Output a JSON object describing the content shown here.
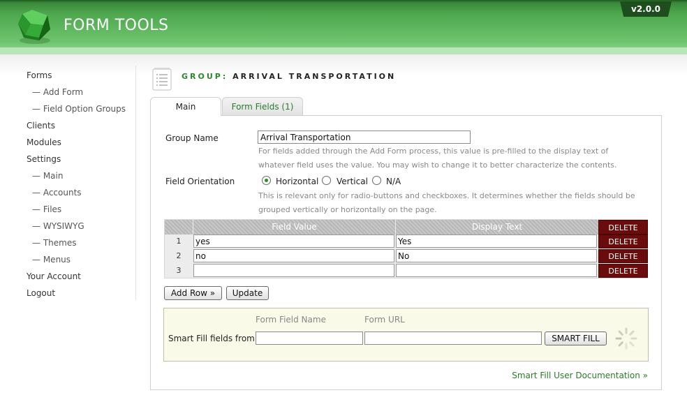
{
  "app": {
    "title": "FORM TOOLS",
    "version": "v2.0.0"
  },
  "sidebar": {
    "items": [
      {
        "label": "Forms",
        "sub": false
      },
      {
        "label": "Add Form",
        "sub": true
      },
      {
        "label": "Field Option Groups",
        "sub": true
      },
      {
        "label": "Clients",
        "sub": false
      },
      {
        "label": "Modules",
        "sub": false
      },
      {
        "label": "Settings",
        "sub": false
      },
      {
        "label": "Main",
        "sub": true
      },
      {
        "label": "Accounts",
        "sub": true
      },
      {
        "label": "Files",
        "sub": true
      },
      {
        "label": "WYSIWYG",
        "sub": true
      },
      {
        "label": "Themes",
        "sub": true
      },
      {
        "label": "Menus",
        "sub": true
      },
      {
        "label": "Your Account",
        "sub": false
      },
      {
        "label": "Logout",
        "sub": false
      }
    ]
  },
  "page": {
    "title_label": "GROUP:",
    "title_name": "ARRIVAL TRANSPORTATION"
  },
  "tabs": [
    {
      "label": "Main"
    },
    {
      "label": "Form Fields (1)"
    }
  ],
  "form": {
    "group_name_label": "Group Name",
    "group_name_value": "Arrival Transportation",
    "group_name_help": "For fields added through the Add Form process, this value is pre-filled to the display text of whatever field uses the value. You may wish to change it to better characterize the contents.",
    "orientation_label": "Field Orientation",
    "orientation_options": [
      "Horizontal",
      "Vertical",
      "N/A"
    ],
    "orientation_selected": "Horizontal",
    "orientation_help": "This is relevant only for radio-buttons and checkboxes. It determines whether the fields should be grouped vertically or horizontally on the page."
  },
  "table": {
    "headers": {
      "value": "Field Value",
      "display": "Display Text",
      "delete": "DELETE"
    },
    "rows": [
      {
        "num": "1",
        "value": "yes",
        "display": "Yes",
        "delete": "DELETE"
      },
      {
        "num": "2",
        "value": "no",
        "display": "No",
        "delete": "DELETE"
      },
      {
        "num": "3",
        "value": "",
        "display": "",
        "delete": "DELETE"
      }
    ]
  },
  "buttons": {
    "add_row": "Add Row »",
    "update": "Update"
  },
  "smart_fill": {
    "label": "Smart Fill fields from:",
    "field_name_header": "Form Field Name",
    "url_header": "Form URL",
    "field_name_value": "",
    "url_value": "",
    "button": "SMART FILL"
  },
  "doc_link": "Smart Fill User Documentation »"
}
